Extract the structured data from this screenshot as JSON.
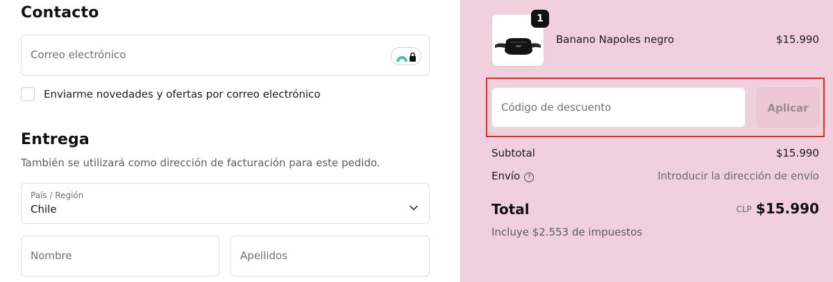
{
  "contact": {
    "heading": "Contacto",
    "email_placeholder": "Correo electrónico",
    "newsletter_label": "Enviarme novedades y ofertas por correo electrónico"
  },
  "delivery": {
    "heading": "Entrega",
    "subtitle": "También se utilizará como dirección de facturación para este pedido.",
    "country_label": "País / Región",
    "country_value": "Chile",
    "first_name_placeholder": "Nombre",
    "last_name_placeholder": "Apellidos"
  },
  "order": {
    "product": {
      "quantity": "1",
      "name": "Banano Napoles negro",
      "price": "$15.990"
    },
    "discount": {
      "placeholder": "Código de descuento",
      "apply_label": "Aplicar"
    },
    "subtotal_label": "Subtotal",
    "subtotal_value": "$15.990",
    "shipping_label": "Envío",
    "shipping_value": "Introducir la dirección de envío",
    "total_label": "Total",
    "currency": "CLP",
    "total_value": "$15.990",
    "tax_note": "Incluye $2.553 de impuestos"
  },
  "colors": {
    "summary_bg": "#f0d0dc",
    "highlight": "#e3262e",
    "apply_bg": "#ecc8d5"
  }
}
